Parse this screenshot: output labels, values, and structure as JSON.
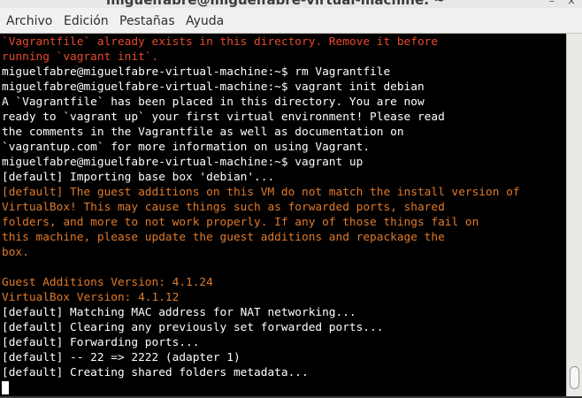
{
  "window": {
    "title": "miguelfabre@miguelfabre-virtual-machine: ~",
    "close_glyph": "×"
  },
  "menubar": {
    "items": [
      "Archivo",
      "Edición",
      "Pestañas",
      "Ayuda"
    ]
  },
  "terminal": {
    "colors": {
      "background": "#000000",
      "normal": "#ffffff",
      "error": "#e84a2c",
      "warning": "#e07a2a"
    },
    "lines": [
      {
        "text": "`Vagrantfile` already exists in this directory. Remove it before",
        "style": "red"
      },
      {
        "text": "running `vagrant init`.",
        "style": "red"
      },
      {
        "text": "miguelfabre@miguelfabre-virtual-machine:~$ rm Vagrantfile",
        "style": "white"
      },
      {
        "text": "miguelfabre@miguelfabre-virtual-machine:~$ vagrant init debian",
        "style": "white"
      },
      {
        "text": "A `Vagrantfile` has been placed in this directory. You are now",
        "style": "white"
      },
      {
        "text": "ready to `vagrant up` your first virtual environment! Please read",
        "style": "white"
      },
      {
        "text": "the comments in the Vagrantfile as well as documentation on",
        "style": "white"
      },
      {
        "text": "`vagrantup.com` for more information on using Vagrant.",
        "style": "white"
      },
      {
        "text": "miguelfabre@miguelfabre-virtual-machine:~$ vagrant up",
        "style": "white"
      },
      {
        "text": "[default] Importing base box 'debian'...",
        "style": "white"
      },
      {
        "text": "[default] The guest additions on this VM do not match the install version of",
        "style": "orange"
      },
      {
        "text": "VirtualBox! This may cause things such as forwarded ports, shared",
        "style": "orange"
      },
      {
        "text": "folders, and more to not work properly. If any of those things fail on",
        "style": "orange"
      },
      {
        "text": "this machine, please update the guest additions and repackage the",
        "style": "orange"
      },
      {
        "text": "box.",
        "style": "orange"
      },
      {
        "text": "",
        "style": "white"
      },
      {
        "text": "Guest Additions Version: 4.1.24",
        "style": "orange"
      },
      {
        "text": "VirtualBox Version: 4.1.12",
        "style": "orange"
      },
      {
        "text": "[default] Matching MAC address for NAT networking...",
        "style": "white"
      },
      {
        "text": "[default] Clearing any previously set forwarded ports...",
        "style": "white"
      },
      {
        "text": "[default] Forwarding ports...",
        "style": "white"
      },
      {
        "text": "[default] -- 22 => 2222 (adapter 1)",
        "style": "white"
      },
      {
        "text": "[default] Creating shared folders metadata...",
        "style": "white"
      }
    ]
  }
}
